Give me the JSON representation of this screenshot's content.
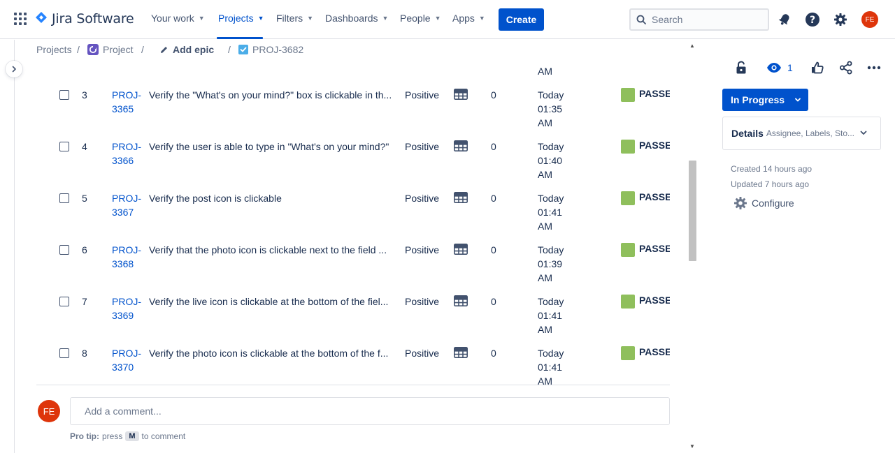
{
  "topnav": {
    "product_name": "Jira Software",
    "items": [
      {
        "label": "Your work"
      },
      {
        "label": "Projects"
      },
      {
        "label": "Filters"
      },
      {
        "label": "Dashboards"
      },
      {
        "label": "People"
      },
      {
        "label": "Apps"
      }
    ],
    "active_item": "Projects",
    "create_label": "Create",
    "search_placeholder": "Search",
    "avatar_initials": "FE"
  },
  "breadcrumb": {
    "projects": "Projects",
    "project": "Project",
    "add_epic": "Add epic",
    "issue_key": "PROJ-3682"
  },
  "table": {
    "partial_top_time": "AM",
    "rows": [
      {
        "index": "3",
        "key": "PROJ-3365",
        "summary": "Verify the \"What's on your mind?\" box is clickable in th...",
        "type": "Positive",
        "count": "0",
        "time": [
          "Today",
          "01:35",
          "AM"
        ],
        "status": "PASSE"
      },
      {
        "index": "4",
        "key": "PROJ-3366",
        "summary": "Verify the user is able to type in \"What's on your mind?\"",
        "type": "Positive",
        "count": "0",
        "time": [
          "Today",
          "01:40",
          "AM"
        ],
        "status": "PASSE"
      },
      {
        "index": "5",
        "key": "PROJ-3367",
        "summary": "Verify the post icon is clickable",
        "type": "Positive",
        "count": "0",
        "time": [
          "Today",
          "01:41",
          "AM"
        ],
        "status": "PASSE"
      },
      {
        "index": "6",
        "key": "PROJ-3368",
        "summary": "Verify that the photo icon is clickable next to the field ...",
        "type": "Positive",
        "count": "0",
        "time": [
          "Today",
          "01:39",
          "AM"
        ],
        "status": "PASSE"
      },
      {
        "index": "7",
        "key": "PROJ-3369",
        "summary": "Verify the live icon is clickable at the bottom of the fiel...",
        "type": "Positive",
        "count": "0",
        "time": [
          "Today",
          "01:41",
          "AM"
        ],
        "status": "PASSE"
      },
      {
        "index": "8",
        "key": "PROJ-3370",
        "summary": "Verify the photo icon is clickable at the bottom of the f...",
        "type": "Positive",
        "count": "0",
        "time": [
          "Today",
          "01:41",
          "AM"
        ],
        "status": "PASSE"
      }
    ]
  },
  "comment": {
    "avatar_initials": "FE",
    "placeholder": "Add a comment...",
    "protip_label": "Pro tip:",
    "protip_press": "press",
    "protip_key": "M",
    "protip_rest": "to comment"
  },
  "right_panel": {
    "watch_count": "1",
    "status_label": "In Progress",
    "details_title": "Details",
    "details_subtitle": "Assignee, Labels, Sto...",
    "created": "Created 14 hours ago",
    "updated": "Updated 7 hours ago",
    "configure_label": "Configure"
  },
  "colors": {
    "brand_blue": "#0052cc",
    "status_green": "#8fbf5c",
    "avatar_red": "#de350b"
  }
}
